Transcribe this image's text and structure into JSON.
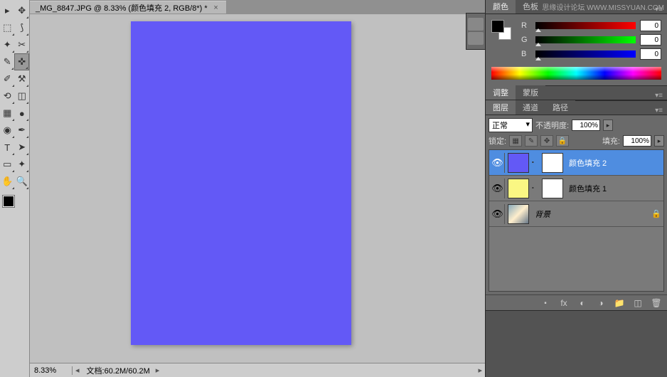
{
  "watermark": "思缘设计论坛  WWW.MISSYUAN.COM",
  "document": {
    "tab_label": "_MG_8847.JPG @ 8.33% (颜色填充 2, RGB/8*) *",
    "zoom": "8.33%",
    "doc_size": "文档:60.2M/60.2M"
  },
  "tools": {
    "names": [
      "move",
      "marquee",
      "lasso",
      "wand",
      "crop",
      "eyedropper",
      "healing",
      "brush",
      "stamp",
      "history-brush",
      "eraser",
      "gradient",
      "blur",
      "dodge",
      "pen",
      "type",
      "path-select",
      "rectangle",
      "hand",
      "zoom"
    ]
  },
  "color_panel": {
    "tab_color": "颜色",
    "tab_swatches": "色板",
    "r": {
      "label": "R",
      "value": "0"
    },
    "g": {
      "label": "G",
      "value": "0"
    },
    "b": {
      "label": "B",
      "value": "0"
    }
  },
  "adjust_panel": {
    "tab_adjust": "调整",
    "tab_mask": "蒙版"
  },
  "layers_panel": {
    "tab_layers": "图层",
    "tab_channels": "通道",
    "tab_paths": "路径",
    "blend_mode": "正常",
    "opacity_label": "不透明度:",
    "opacity_value": "100%",
    "lock_label": "锁定:",
    "fill_label": "填充:",
    "fill_value": "100%",
    "layers": [
      {
        "name": "颜色填充 2",
        "selected": true,
        "thumb": "fill-blue",
        "mask": true
      },
      {
        "name": "颜色填充 1",
        "selected": false,
        "thumb": "fill-yellow",
        "mask": true
      },
      {
        "name": "背景",
        "selected": false,
        "thumb": "img",
        "mask": false,
        "locked": true
      }
    ]
  }
}
